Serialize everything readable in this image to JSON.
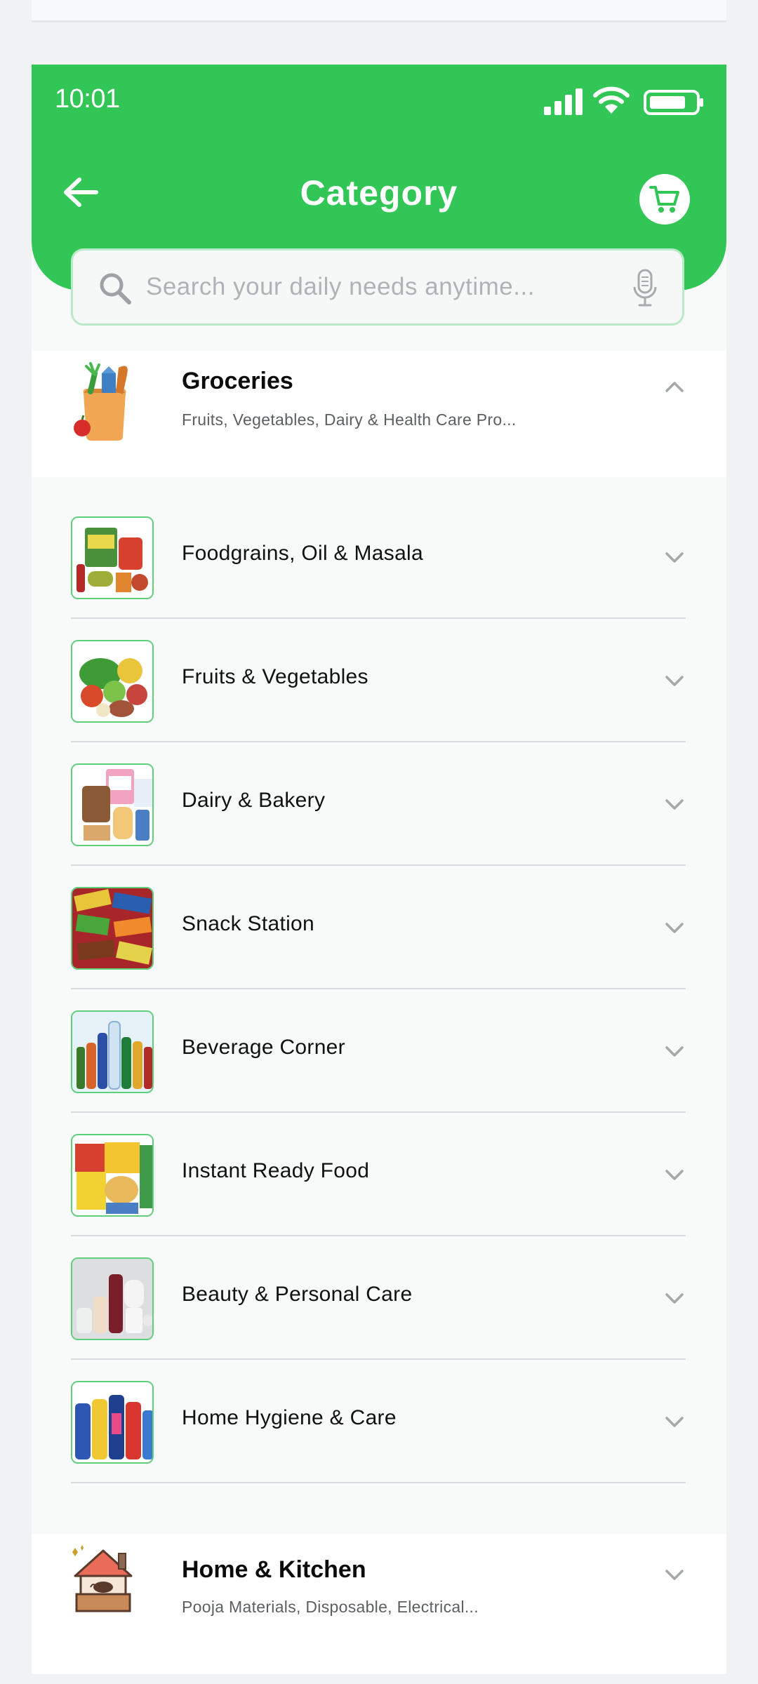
{
  "status_bar": {
    "time": "10:01"
  },
  "header": {
    "title": "Category"
  },
  "search": {
    "placeholder": "Search your daily needs anytime..."
  },
  "categories": [
    {
      "name": "Groceries",
      "description": "Fruits, Vegetables, Dairy & Health Care Pro...",
      "icon": "grocery-bag-icon",
      "expanded": true,
      "subcategories": [
        {
          "label": "Foodgrains, Oil & Masala"
        },
        {
          "label": "Fruits & Vegetables"
        },
        {
          "label": "Dairy & Bakery"
        },
        {
          "label": "Snack Station"
        },
        {
          "label": "Beverage Corner"
        },
        {
          "label": "Instant Ready Food"
        },
        {
          "label": "Beauty & Personal Care"
        },
        {
          "label": "Home Hygiene & Care"
        }
      ]
    },
    {
      "name": "Home & Kitchen",
      "description": "Pooja Materials, Disposable, Electrical...",
      "icon": "house-kitchen-icon",
      "expanded": false
    }
  ],
  "colors": {
    "brand_green": "#32c656",
    "border_green": "#5fcf7c"
  }
}
